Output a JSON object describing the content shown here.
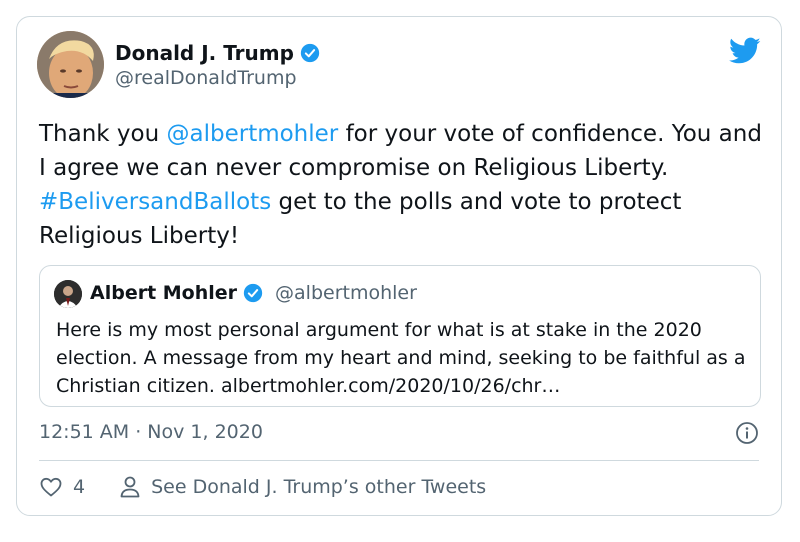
{
  "author": {
    "name": "Donald J. Trump",
    "handle": "@realDonaldTrump"
  },
  "tweet": {
    "text_parts": [
      {
        "text": "Thank you ",
        "link": false
      },
      {
        "text": "@albertmohler",
        "link": true
      },
      {
        "text": " for your vote of confidence. You and I agree we can never compromise on Religious Liberty. ",
        "link": false
      },
      {
        "text": "#BeliversandBallots",
        "link": true
      },
      {
        "text": " get to the polls and vote to protect Religious Liberty!",
        "link": false
      }
    ]
  },
  "quote": {
    "name": "Albert Mohler",
    "handle": "@albertmohler",
    "text": "Here is my most personal argument for what is at stake in the 2020 election. A message from my heart and mind, seeking to be faithful as a Christian citizen. albertmohler.com/2020/10/26/chr…"
  },
  "timestamp": "12:51 AM · Nov 1, 2020",
  "footer": {
    "like_count": "4",
    "other_tweets_label": "See Donald J. Trump’s other Tweets"
  },
  "colors": {
    "link": "#1d9bf0",
    "secondary_text": "#536471",
    "border": "#cfd9de"
  },
  "icons": [
    "verified-badge-icon",
    "twitter-bird-icon",
    "info-icon",
    "heart-icon",
    "person-icon"
  ]
}
